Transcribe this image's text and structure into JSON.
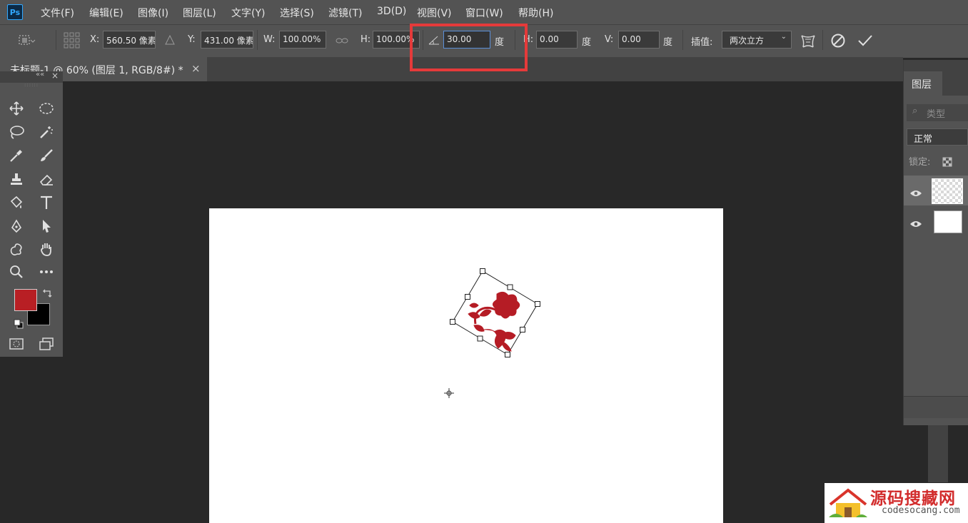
{
  "app": {
    "logo": "Ps"
  },
  "menu": [
    "文件(F)",
    "编辑(E)",
    "图像(I)",
    "图层(L)",
    "文字(Y)",
    "选择(S)",
    "滤镜(T)",
    "3D(D)",
    "视图(V)",
    "窗口(W)",
    "帮助(H)"
  ],
  "options": {
    "x_label": "X:",
    "x_value": "560.50 像素",
    "y_label": "Y:",
    "y_value": "431.00 像素",
    "w_label": "W:",
    "w_value": "100.00%",
    "h_label": "H:",
    "h_value": "100.00%",
    "angle_value": "30.00",
    "angle_unit": "度",
    "hskew_label": "H:",
    "hskew_value": "0.00",
    "hskew_unit": "度",
    "vskew_label": "V:",
    "vskew_value": "0.00",
    "vskew_unit": "度",
    "interp_label": "插值:",
    "interp_value": "两次立方"
  },
  "document_tab": {
    "title": "未标题-1 @ 60% (图层 1, RGB/8#) *",
    "close": "×"
  },
  "toolbox": {
    "collapse": "««",
    "close": "×",
    "grip": "::::::"
  },
  "colors": {
    "foreground": "#b81f24",
    "background": "#000000",
    "highlight": "#e53a3a",
    "flower": "#b51c25"
  },
  "layers_panel": {
    "tab": "图层",
    "search_placeholder": "类型",
    "blend_mode": "正常",
    "lock_label": "锁定:"
  },
  "watermark": {
    "title": "源码搜藏网",
    "url": "codesocang.com"
  }
}
